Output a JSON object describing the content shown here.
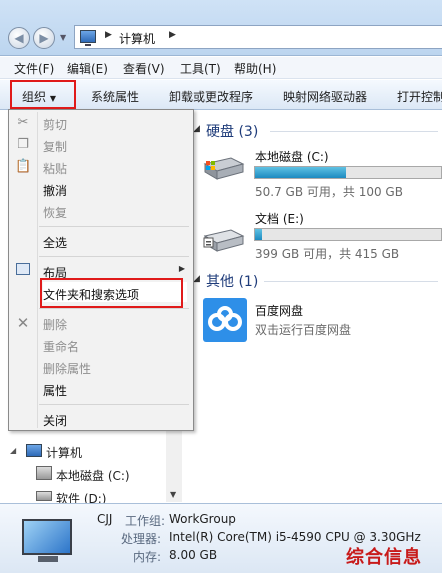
{
  "address": {
    "location": "计算机"
  },
  "menubar": {
    "file": "文件(F)",
    "edit": "编辑(E)",
    "view": "查看(V)",
    "tools": "工具(T)",
    "help": "帮助(H)"
  },
  "toolbar": {
    "organize": "组织",
    "system_properties": "系统属性",
    "uninstall": "卸载或更改程序",
    "map_drive": "映射网络驱动器",
    "control_panel": "打开控制"
  },
  "organize_menu": {
    "cut": "剪切",
    "copy": "复制",
    "paste": "粘贴",
    "undo": "撤消",
    "redo": "恢复",
    "select_all": "全选",
    "layout": "布局",
    "folder_options": "文件夹和搜索选项",
    "delete": "删除",
    "rename": "重命名",
    "remove_properties": "删除属性",
    "properties": "属性",
    "close": "关闭"
  },
  "nav": {
    "computer": "计算机",
    "local_disk_c": "本地磁盘 (C:)",
    "software_d": "软件 (D:)"
  },
  "content": {
    "hdd_group": "硬盘 (3)",
    "other_group": "其他 (1)",
    "drives": [
      {
        "name": "本地磁盘 (C:)",
        "size": "50.7 GB 可用，共 100 GB",
        "used_fraction": 0.49
      },
      {
        "name": "文档 (E:)",
        "size": "399 GB 可用，共 415 GB",
        "used_fraction": 0.04
      }
    ],
    "baidu": {
      "name": "百度网盘",
      "desc": "双击运行百度网盘"
    }
  },
  "details": {
    "name": "CJJ",
    "workgroup_label": "工作组:",
    "workgroup": "WorkGroup",
    "cpu_label": "处理器:",
    "cpu": "Intel(R) Core(TM) i5-4590 CPU @ 3.30GHz",
    "mem_label": "内存:",
    "mem": "8.00 GB"
  },
  "watermark": "综合信息"
}
